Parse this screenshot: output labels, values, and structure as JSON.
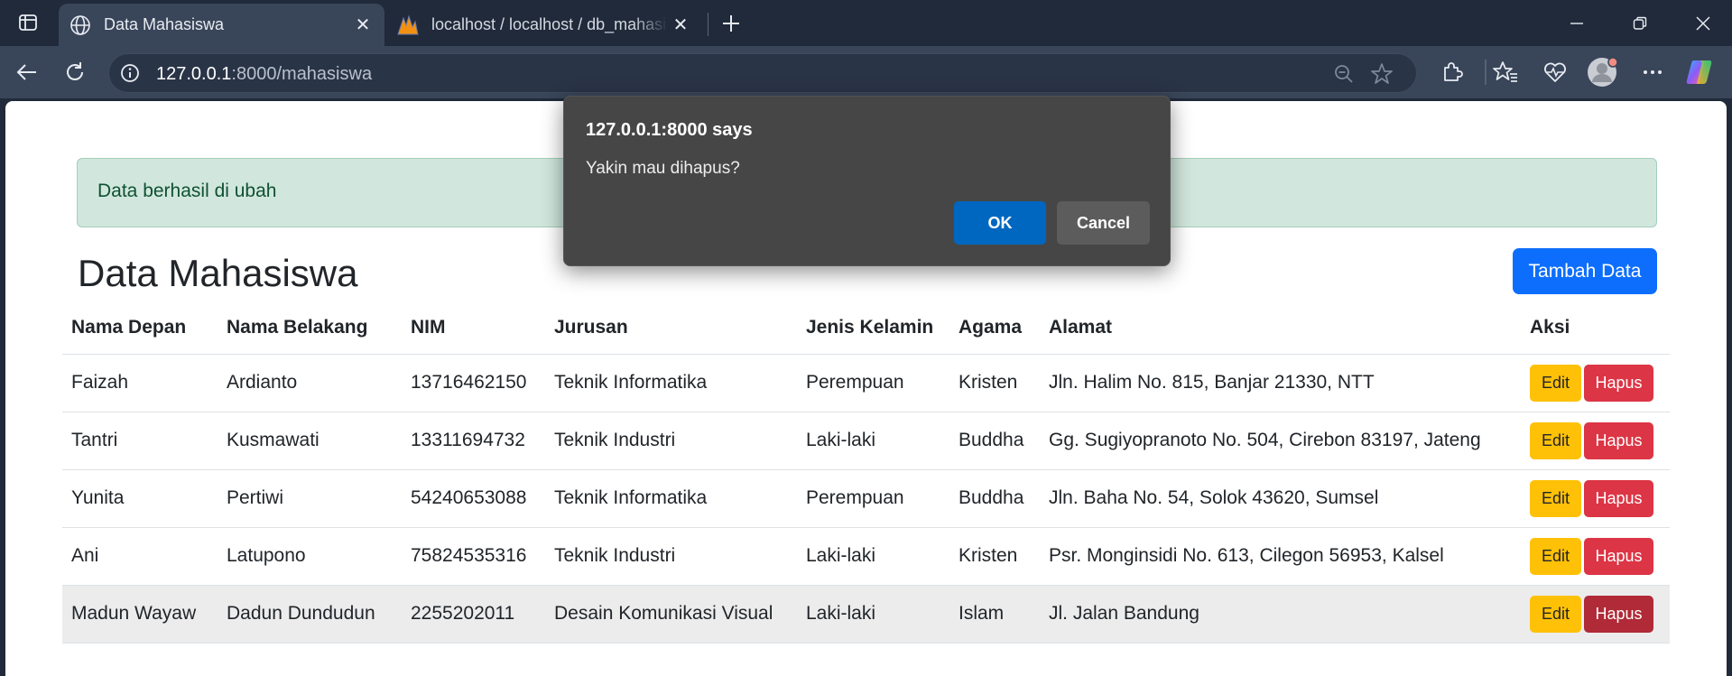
{
  "browser": {
    "tabs": [
      {
        "title": "Data Mahasiswa",
        "active": true
      },
      {
        "title": "localhost / localhost / db_mahasiswa",
        "active": false
      }
    ],
    "url_host": "127.0.0.1",
    "url_rest": ":8000/mahasiswa"
  },
  "alert": {
    "text": "Data berhasil di ubah"
  },
  "page": {
    "title": "Data Mahasiswa",
    "add_button": "Tambah Data"
  },
  "table": {
    "headers": [
      "Nama Depan",
      "Nama Belakang",
      "NIM",
      "Jurusan",
      "Jenis Kelamin",
      "Agama",
      "Alamat",
      "Aksi"
    ],
    "rows": [
      {
        "nama_depan": "Faizah",
        "nama_belakang": "Ardianto",
        "nim": "13716462150",
        "jurusan": "Teknik Informatika",
        "jenis_kelamin": "Perempuan",
        "agama": "Kristen",
        "alamat": "Jln. Halim No. 815, Banjar 21330, NTT"
      },
      {
        "nama_depan": "Tantri",
        "nama_belakang": "Kusmawati",
        "nim": "13311694732",
        "jurusan": "Teknik Industri",
        "jenis_kelamin": "Laki-laki",
        "agama": "Buddha",
        "alamat": "Gg. Sugiyopranoto No. 504, Cirebon 83197, Jateng"
      },
      {
        "nama_depan": "Yunita",
        "nama_belakang": "Pertiwi",
        "nim": "54240653088",
        "jurusan": "Teknik Informatika",
        "jenis_kelamin": "Perempuan",
        "agama": "Buddha",
        "alamat": "Jln. Baha No. 54, Solok 43620, Sumsel"
      },
      {
        "nama_depan": "Ani",
        "nama_belakang": "Latupono",
        "nim": "75824535316",
        "jurusan": "Teknik Industri",
        "jenis_kelamin": "Laki-laki",
        "agama": "Kristen",
        "alamat": "Psr. Monginsidi No. 613, Cilegon 56953, Kalsel"
      },
      {
        "nama_depan": "Madun Wayaw",
        "nama_belakang": "Dadun Dundudun",
        "nim": "2255202011",
        "jurusan": "Desain Komunikasi Visual",
        "jenis_kelamin": "Laki-laki",
        "agama": "Islam",
        "alamat": "Jl. Jalan Bandung"
      }
    ],
    "edit_label": "Edit",
    "delete_label": "Hapus"
  },
  "dialog": {
    "title": "127.0.0.1:8000 says",
    "message": "Yakin mau dihapus?",
    "ok": "OK",
    "cancel": "Cancel"
  },
  "colors": {
    "primary": "#0d6efd",
    "warning": "#ffc107",
    "danger": "#dc3545",
    "success_bg": "#d1e7dd",
    "dialog_ok": "#0067c0"
  }
}
